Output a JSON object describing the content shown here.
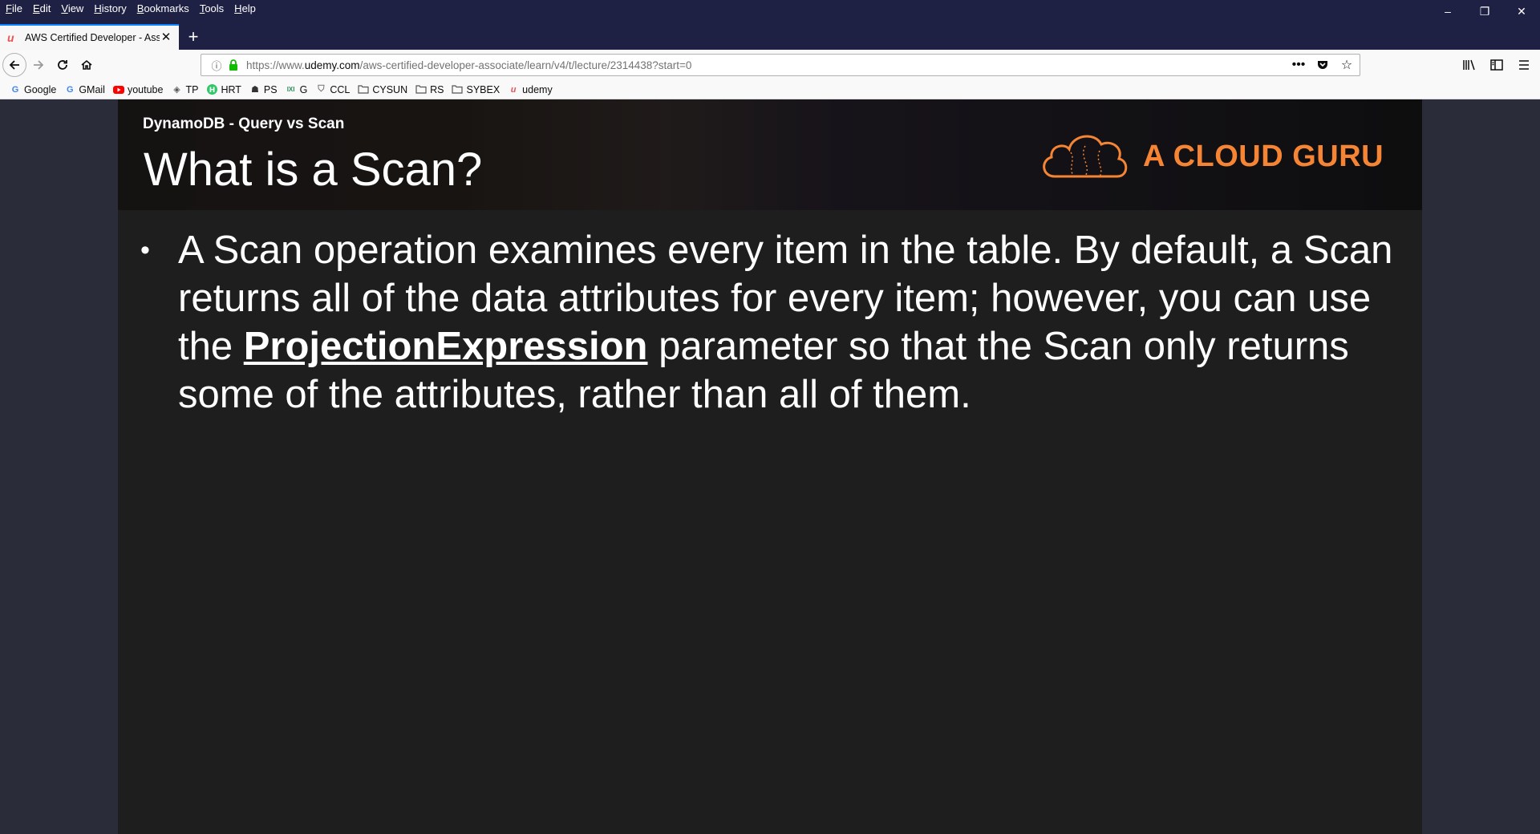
{
  "menu": [
    "File",
    "Edit",
    "View",
    "History",
    "Bookmarks",
    "Tools",
    "Help"
  ],
  "window_controls": {
    "minimize": "–",
    "restore": "❐",
    "close": "✕"
  },
  "tab": {
    "title": "AWS Certified Developer - Asso",
    "favicon": "udemy-icon",
    "close": "✕",
    "new_tab": "+"
  },
  "urlbar": {
    "prefix": "https://www.",
    "domain": "udemy.com",
    "path": "/aws-certified-developer-associate/learn/v4/t/lecture/2314438?start=0"
  },
  "bookmarks": [
    {
      "label": "Google",
      "icon": "google-icon",
      "color": "#4285f4"
    },
    {
      "label": "GMail",
      "icon": "google-icon",
      "color": "#4285f4"
    },
    {
      "label": "youtube",
      "icon": "youtube-icon",
      "color": "#ff0000"
    },
    {
      "label": "TP",
      "icon": "tp-icon",
      "color": "#555555"
    },
    {
      "label": "HRT",
      "icon": "hackerrank-icon",
      "color": "#2ec866"
    },
    {
      "label": "PS",
      "icon": "ps-icon",
      "color": "#333333"
    },
    {
      "label": "G",
      "icon": "g-icon",
      "color": "#2e8b57"
    },
    {
      "label": "CCL",
      "icon": "ccl-icon",
      "color": "#777777"
    },
    {
      "label": "CYSUN",
      "icon": "folder-icon",
      "color": "#555555"
    },
    {
      "label": "RS",
      "icon": "folder-icon",
      "color": "#555555"
    },
    {
      "label": "SYBEX",
      "icon": "folder-icon",
      "color": "#555555"
    },
    {
      "label": "udemy",
      "icon": "udemy-icon",
      "color": "#ec5252"
    }
  ],
  "slide": {
    "subtitle": "DynamoDB - Query vs Scan",
    "title": "What is a Scan?",
    "logo_text": "A CLOUD GURU",
    "bullet_part1": "A Scan operation examines every item in the table. By default, a Scan returns all of the data attributes for every item; however, you can use the ",
    "bullet_bold": "ProjectionExpression",
    "bullet_part2": " parameter so that the Scan only returns some of the attributes, rather than all of them."
  },
  "colors": {
    "chrome_dark": "#1f2144",
    "accent_blue": "#0a84ff",
    "brand_orange": "#f58534",
    "slide_bg": "#1e1e1e"
  }
}
